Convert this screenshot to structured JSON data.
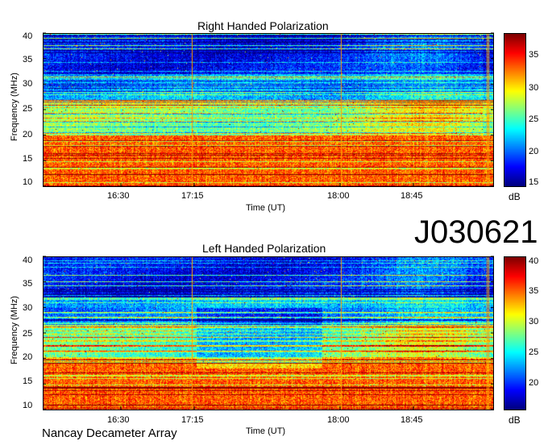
{
  "identifier": "J030621",
  "footer": "Nancay Decameter Array",
  "chart_data": [
    {
      "type": "heatmap",
      "title": "Right Handed Polarization",
      "xlabel": "Time (UT)",
      "ylabel": "Frequency (MHz)",
      "x_ticks": [
        "16:30",
        "17:15",
        "18:00",
        "18:45"
      ],
      "y_ticks": [
        10,
        15,
        20,
        25,
        30,
        35,
        40
      ],
      "ylim": [
        10,
        40
      ],
      "xlim_minutes_ut": [
        960,
        1140
      ],
      "colorbar": {
        "label": "dB",
        "ticks": [
          15,
          20,
          25,
          30,
          35
        ],
        "range": [
          15,
          38
        ],
        "colormap": "jet"
      }
    },
    {
      "type": "heatmap",
      "title": "Left Handed Polarization",
      "xlabel": "Time (UT)",
      "ylabel": "Frequency (MHz)",
      "x_ticks": [
        "16:30",
        "17:15",
        "18:00",
        "18:45"
      ],
      "y_ticks": [
        10,
        15,
        20,
        25,
        30,
        35,
        40
      ],
      "ylim": [
        10,
        40
      ],
      "xlim_minutes_ut": [
        960,
        1140
      ],
      "colorbar": {
        "label": "dB",
        "ticks": [
          20,
          25,
          30,
          35,
          40
        ],
        "range": [
          16,
          41
        ],
        "colormap": "jet"
      }
    }
  ]
}
